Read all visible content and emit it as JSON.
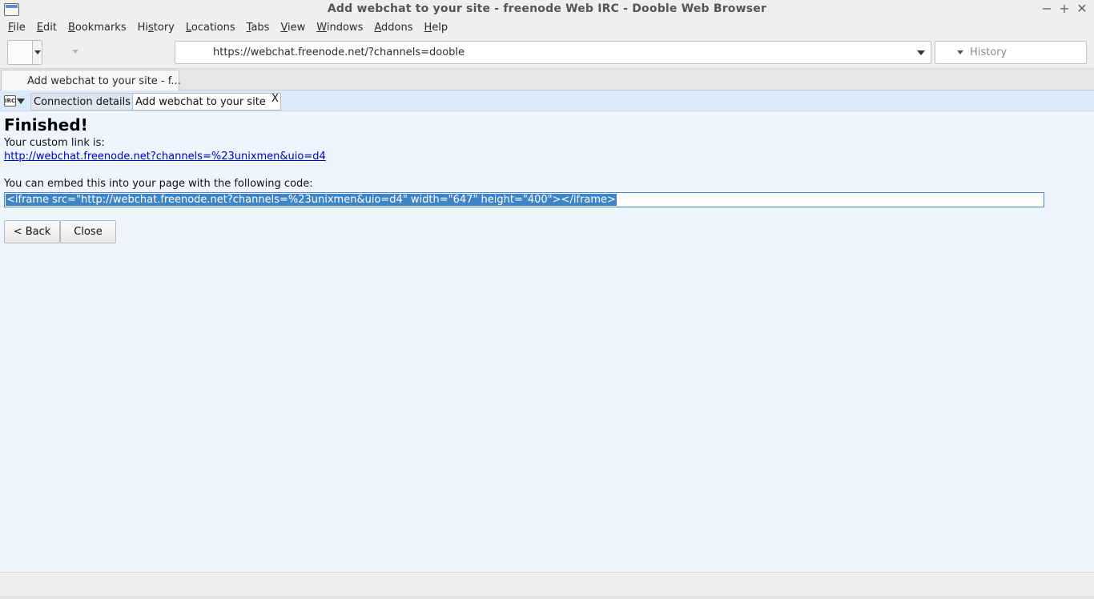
{
  "window": {
    "title": "Add webchat to your site - freenode Web IRC - Dooble Web Browser",
    "controls": {
      "minimize": "−",
      "maximize": "+",
      "close": "✕"
    }
  },
  "menu": [
    {
      "prefix": "",
      "mnemonic": "F",
      "rest": "ile"
    },
    {
      "prefix": "",
      "mnemonic": "E",
      "rest": "dit"
    },
    {
      "prefix": "",
      "mnemonic": "B",
      "rest": "ookmarks"
    },
    {
      "prefix": "Hi",
      "mnemonic": "s",
      "rest": "tory"
    },
    {
      "prefix": "",
      "mnemonic": "L",
      "rest": "ocations"
    },
    {
      "prefix": "",
      "mnemonic": "T",
      "rest": "abs"
    },
    {
      "prefix": "",
      "mnemonic": "V",
      "rest": "iew"
    },
    {
      "prefix": "",
      "mnemonic": "W",
      "rest": "indows"
    },
    {
      "prefix": "",
      "mnemonic": "A",
      "rest": "ddons"
    },
    {
      "prefix": "",
      "mnemonic": "H",
      "rest": "elp"
    }
  ],
  "toolbar": {
    "url": "https://webchat.freenode.net/?channels=dooble",
    "history_placeholder": "History"
  },
  "tabs": [
    {
      "label": "Add webchat to your site - f..."
    }
  ],
  "irc": {
    "icon_text": "IRC",
    "tabs": [
      {
        "label": "Connection details",
        "active": false
      },
      {
        "label": "Add webchat to your site",
        "active": true
      }
    ],
    "close_label": "X"
  },
  "page": {
    "heading": "Finished!",
    "custom_link_label": "Your custom link is:",
    "custom_link": "http://webchat.freenode.net?channels=%23unixmen&uio=d4",
    "embed_label": "You can embed this into your page with the following code:",
    "embed_code": "<iframe src=\"http://webchat.freenode.net?channels=%23unixmen&uio=d4\" width=\"647\" height=\"400\"></iframe>",
    "back_button": "< Back",
    "close_button": "Close"
  }
}
